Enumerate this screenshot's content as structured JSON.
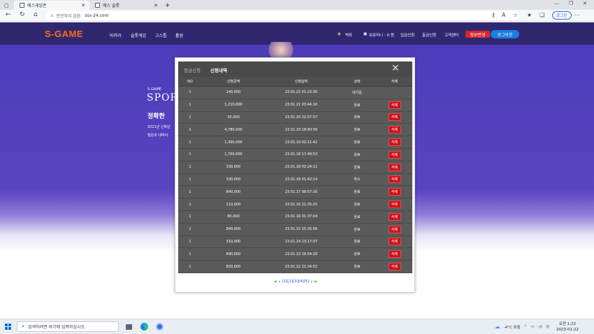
{
  "browser": {
    "tabs": [
      {
        "label": "에스게임존",
        "active": true
      },
      {
        "label": "에스 슬롯",
        "active": false
      }
    ],
    "security_label": "안전하지 않음",
    "url": "sss-24.com",
    "profile_button": "로그인"
  },
  "site": {
    "logo": "S-GAME",
    "nav": [
      "바카라",
      "슬롯게임",
      "고스톱",
      "홀덤"
    ],
    "balance_label": "보유머니 : 0 원",
    "points_label": "벅좌",
    "header_links": [
      "입금신청",
      "출금신청",
      "고객센터"
    ],
    "info_change_button": "정보변경",
    "logout_button": "로그아웃",
    "hero": {
      "small": "S-GAME",
      "big": "SPOR",
      "headline": "정확한 ",
      "line1": "2021년 신축년",
      "line2": "행운과 대박이"
    }
  },
  "modal": {
    "tab_deposit": "충금신청",
    "tab_history": "신청내역",
    "columns": [
      "NO",
      "신청금액",
      "신청날짜",
      "상태",
      "삭제"
    ],
    "delete_label": "삭제",
    "rows": [
      {
        "no": "1",
        "amount": "140,000",
        "date": "23.01.22 01:22:30",
        "status": "대기중",
        "deletable": false
      },
      {
        "no": "1",
        "amount": "1,210,000",
        "date": "23.01.21 03:44:16",
        "status": "완료",
        "deletable": true
      },
      {
        "no": "1",
        "amount": "30,000",
        "date": "23.01.20 22:57:57",
        "status": "완료",
        "deletable": true
      },
      {
        "no": "1",
        "amount": "4,780,000",
        "date": "23.01.19 18:40:39",
        "status": "완료",
        "deletable": true
      },
      {
        "no": "1",
        "amount": "1,300,000",
        "date": "23.01.19 02:11:42",
        "status": "완료",
        "deletable": true
      },
      {
        "no": "1",
        "amount": "1,700,000",
        "date": "23.01.18 17:49:53",
        "status": "완료",
        "deletable": true
      },
      {
        "no": "1",
        "amount": "330,000",
        "date": "23.01.18 02:24:11",
        "status": "완료",
        "deletable": true
      },
      {
        "no": "1",
        "amount": "330,000",
        "date": "23.01.18 01:42:14",
        "status": "취소",
        "deletable": true
      },
      {
        "no": "1",
        "amount": "840,000",
        "date": "23.01.17 00:57:16",
        "status": "완료",
        "deletable": true
      },
      {
        "no": "1",
        "amount": "110,000",
        "date": "23.01.16 21:35:25",
        "status": "완료",
        "deletable": true
      },
      {
        "no": "1",
        "amount": "80,000",
        "date": "23.01.16 01:37:04",
        "status": "완료",
        "deletable": true
      },
      {
        "no": "1",
        "amount": "840,000",
        "date": "23.01.15 15:35:06",
        "status": "완료",
        "deletable": true
      },
      {
        "no": "1",
        "amount": "310,000",
        "date": "23.01.14 23:17:37",
        "status": "완료",
        "deletable": true
      },
      {
        "no": "1",
        "amount": "690,000",
        "date": "23.01.13 16:54:18",
        "status": "완료",
        "deletable": true
      },
      {
        "no": "1",
        "amount": "820,000",
        "date": "23.01.12 21:34:52",
        "status": "완료",
        "deletable": true
      }
    ],
    "pager": {
      "pages": [
        "[1]",
        "[2]",
        "[3]",
        "[4]",
        "[5]"
      ],
      "current": "[1]"
    }
  },
  "taskbar": {
    "search_placeholder": "검색하려면 여기에 입력하십시오.",
    "weather": "-4°C 흐림",
    "time": "오전 1:22",
    "date": "2023-01-22"
  }
}
